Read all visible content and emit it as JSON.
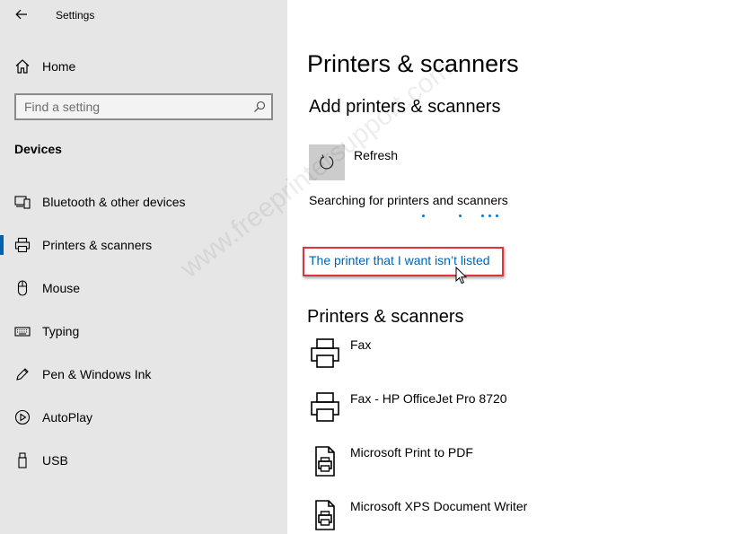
{
  "window": {
    "title": "Settings"
  },
  "sidebar": {
    "home_label": "Home",
    "search": {
      "placeholder": "Find a setting",
      "value": ""
    },
    "section_label": "Devices",
    "items": [
      {
        "label": "Bluetooth & other devices",
        "icon": "bluetooth-devices-icon",
        "active": false
      },
      {
        "label": "Printers & scanners",
        "icon": "printer-icon",
        "active": true
      },
      {
        "label": "Mouse",
        "icon": "mouse-icon",
        "active": false
      },
      {
        "label": "Typing",
        "icon": "keyboard-icon",
        "active": false
      },
      {
        "label": "Pen & Windows Ink",
        "icon": "pen-icon",
        "active": false
      },
      {
        "label": "AutoPlay",
        "icon": "autoplay-icon",
        "active": false
      },
      {
        "label": "USB",
        "icon": "usb-icon",
        "active": false
      }
    ]
  },
  "main": {
    "page_title": "Printers & scanners",
    "add_section": {
      "title": "Add printers & scanners",
      "refresh_label": "Refresh",
      "status_text": "Searching for printers and scanners",
      "not_listed_link": "The printer that I want isn’t listed"
    },
    "list_section": {
      "title": "Printers & scanners",
      "printers": [
        {
          "name": "Fax",
          "icon": "printer-icon"
        },
        {
          "name": "Fax - HP OfficeJet Pro 8720",
          "icon": "printer-icon"
        },
        {
          "name": "Microsoft Print to PDF",
          "icon": "document-printer-icon"
        },
        {
          "name": "Microsoft XPS Document Writer",
          "icon": "document-printer-icon"
        }
      ]
    }
  },
  "watermark": "www.freeprintersupport.com",
  "colors": {
    "accent": "#0063b1",
    "link": "#0063b1",
    "highlight_box": "#e2333a",
    "sidebar_bg": "#e6e6e6",
    "progress_dots": "#0078d7"
  }
}
